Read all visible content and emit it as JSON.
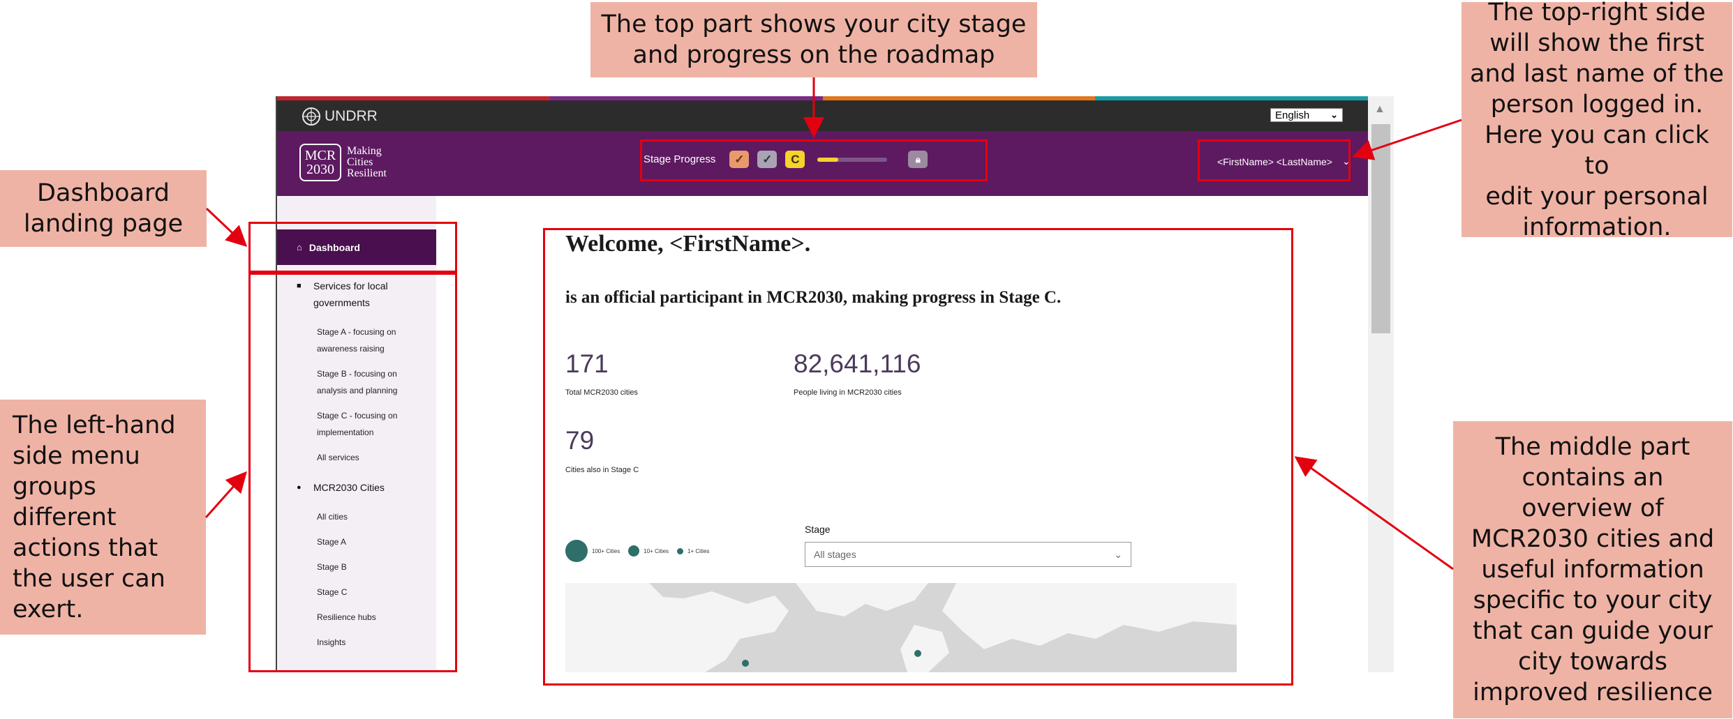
{
  "callouts": {
    "top": [
      "The top part shows your city stage",
      "and progress on the roadmap"
    ],
    "top_right": [
      "The top-right side",
      "will show the first",
      "and last name of the",
      "person logged in.",
      "Here you can click to",
      "edit your personal",
      "information."
    ],
    "dashboard": [
      "Dashboard",
      "landing page"
    ],
    "left": [
      "The left-hand",
      "side menu",
      "groups",
      "different",
      "actions that",
      "the user can",
      "exert."
    ],
    "middle": [
      "The middle part",
      "contains an",
      "overview of",
      "MCR2030 cities and",
      "useful information",
      "specific to your city",
      "that can guide your",
      "city towards",
      "improved resilience"
    ]
  },
  "topbar": {
    "org": "UNDRR",
    "language": "English",
    "stripe_colors": [
      "#c0262d",
      "#7a2b85",
      "#e1761d",
      "#1a9aa4"
    ]
  },
  "header": {
    "logo_mcr": "MCR",
    "logo_year": "2030",
    "logo_text": [
      "Making",
      "Cities",
      "Resilient"
    ],
    "stage_progress_label": "Stage Progress",
    "badges": {
      "a": "✓",
      "b": "✓",
      "c": "C"
    },
    "progress_fraction": 0.3,
    "user_name": "<FirstName> <LastName>"
  },
  "sidebar": {
    "dashboard": "Dashboard",
    "services_heading": "Services for local governments",
    "service_links": [
      "Stage A - focusing on awareness raising",
      "Stage B - focusing on analysis and planning",
      "Stage C - focusing on implementation",
      "All services"
    ],
    "cities_heading": "MCR2030 Cities",
    "city_links": [
      "All cities",
      "Stage A",
      "Stage B",
      "Stage C",
      "Resilience hubs",
      "Insights"
    ]
  },
  "main": {
    "welcome": "Welcome, <FirstName>.",
    "participant": "is an official participant in MCR2030, making progress in Stage C.",
    "stats": [
      {
        "value": "171",
        "label": "Total MCR2030 cities"
      },
      {
        "value": "82,641,116",
        "label": "People living in MCR2030 cities"
      },
      {
        "value": "79",
        "label": "Cities also in Stage C"
      }
    ],
    "legend": [
      "100+ Cities",
      "10+ Cities",
      "1+ Cities"
    ],
    "stage_label": "Stage",
    "stage_select": "All stages"
  }
}
